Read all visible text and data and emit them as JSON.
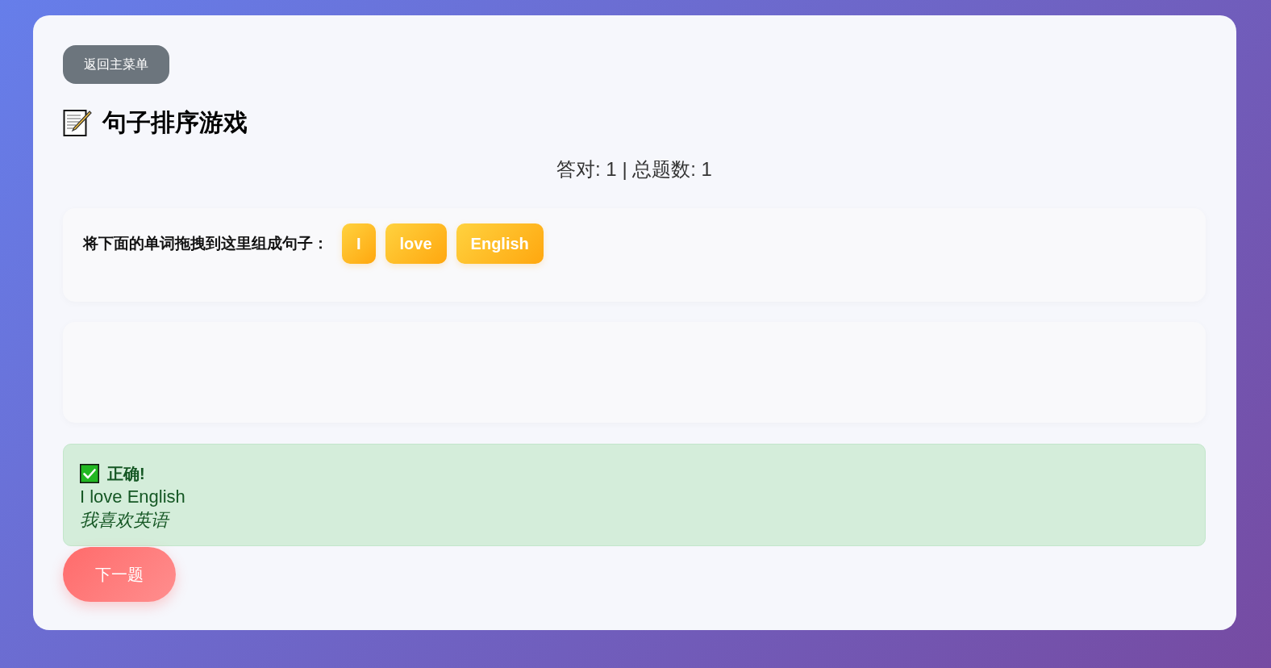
{
  "back_button": {
    "label": "返回主菜单"
  },
  "title": {
    "text": "句子排序游戏"
  },
  "score": {
    "text": "答对: 1 | 总题数: 1"
  },
  "answer_area": {
    "label": "将下面的单词拖拽到这里组成句子：",
    "words": [
      "I",
      "love",
      "English"
    ]
  },
  "feedback": {
    "kind": "correct",
    "heading": "正确!",
    "sentence": "I love English",
    "translation": "我喜欢英语"
  },
  "next_button": {
    "label": "下一题"
  }
}
